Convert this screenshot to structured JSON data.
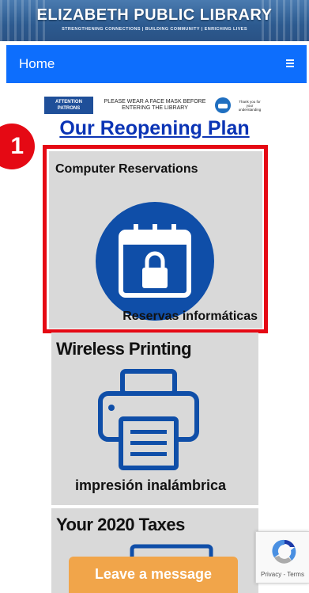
{
  "banner": {
    "title": "ELIZABETH PUBLIC LIBRARY",
    "tagline": "STRENGTHENING CONNECTIONS | BUILDING COMMUNITY | ENRICHING LIVES"
  },
  "nav": {
    "home_label": "Home",
    "menu_icon": "hamburger-icon"
  },
  "notice": {
    "attention": "ATTENTION PATRONS",
    "message": "PLEASE WEAR A FACE MASK BEFORE ENTERING THE LIBRARY",
    "thanks": "Thank you for your understanding"
  },
  "page": {
    "heading": "Our Reopening Plan",
    "step_number": "1"
  },
  "tiles": [
    {
      "title": "Computer Reservations",
      "subtitle": "Reservas informáticas",
      "icon": "calendar-lock-icon"
    },
    {
      "title": "Wireless Printing",
      "subtitle": "impresión inalámbrica",
      "icon": "printer-icon"
    },
    {
      "title": "Your 2020 Taxes",
      "icon": "tax-document-icon"
    }
  ],
  "chat": {
    "label": "Leave a message"
  },
  "recaptcha": {
    "text": "Privacy - Terms"
  },
  "colors": {
    "nav_blue": "#0d6efd",
    "highlight_red": "#e50914",
    "chat_orange": "#f1a54a",
    "calendar_blue": "#0f4ea8"
  }
}
